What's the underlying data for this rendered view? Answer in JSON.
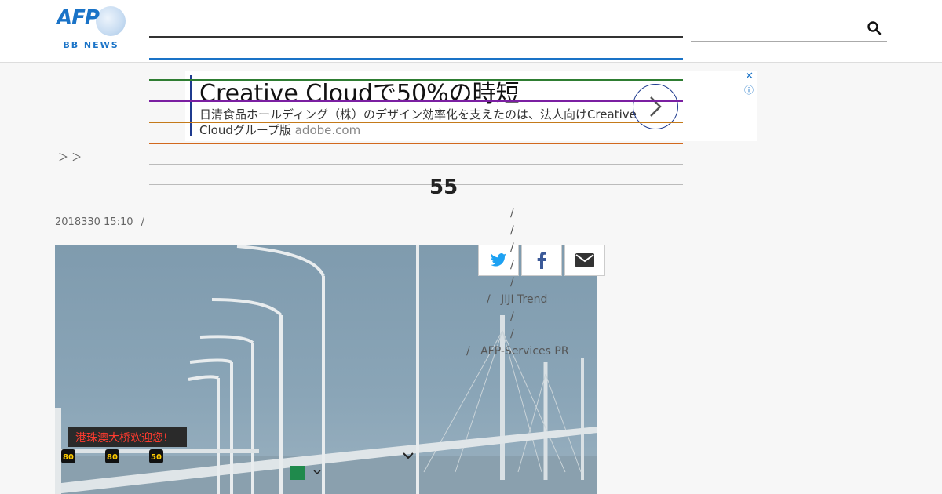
{
  "header": {
    "logo_text": "AFP",
    "logo_sub": "BB NEWS",
    "search_icon": "search-icon",
    "colors": {
      "brand": "#1a73c7"
    }
  },
  "ad": {
    "headline": "Creative Cloudで50%の時短",
    "description": "日清食品ホールディング（株）のデザイン効率化を支えたのは、法人向けCreative Cloudグループ版",
    "domain": "adobe.com",
    "close_icon": "close-icon",
    "info_icon": "info-icon",
    "arrow_icon": "chevron-right-icon"
  },
  "article": {
    "breadcrumb": "＞ ＞",
    "title": "　　　　　　　　　　　　　　　　 　　55　　",
    "meta_date": "2018330 15:10",
    "meta_sep": "/",
    "photo_signboard": "港珠澳大桥欢迎您!",
    "speed_signs": [
      "80",
      "80",
      "50"
    ]
  },
  "share": {
    "twitter_icon": "twitter-icon",
    "facebook_icon": "facebook-icon",
    "email_icon": "envelope-icon"
  },
  "sidebar": {
    "links": [
      {
        "label": ""
      },
      {
        "label": ""
      },
      {
        "label": ""
      },
      {
        "label": ""
      },
      {
        "label": ""
      },
      {
        "label": "JIJI Trend"
      },
      {
        "label": ""
      },
      {
        "label": ""
      },
      {
        "label": "AFP-Services PR"
      }
    ],
    "separator": "/"
  }
}
